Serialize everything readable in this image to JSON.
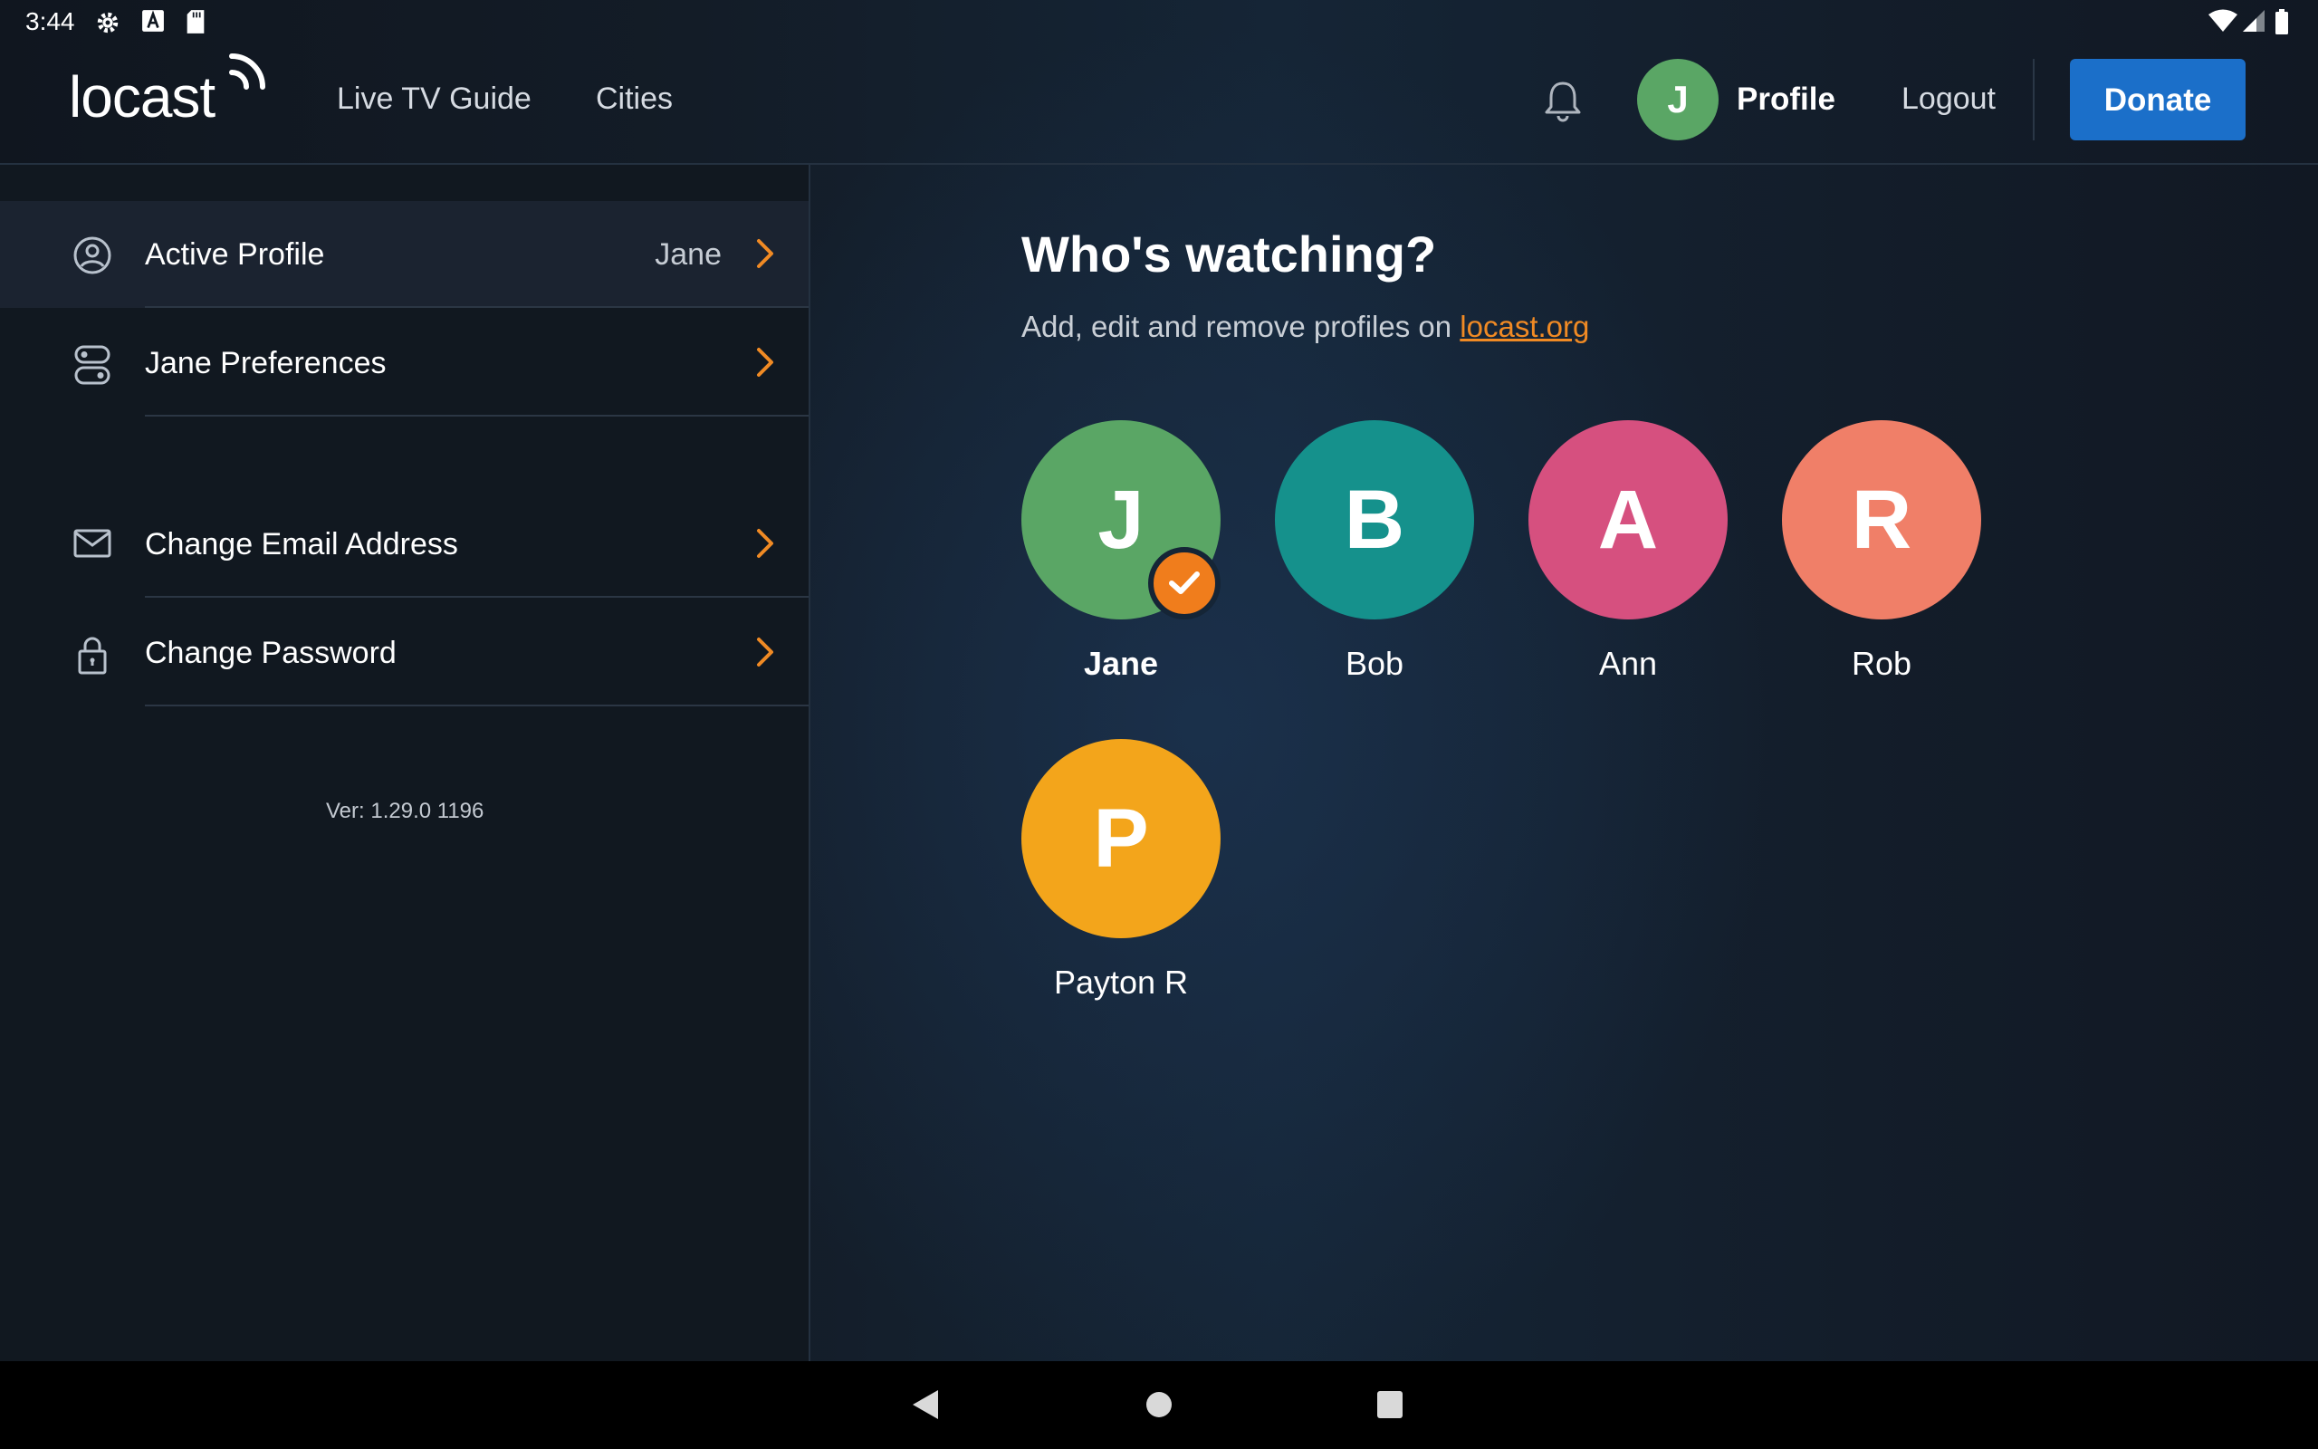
{
  "status_bar": {
    "time": "3:44"
  },
  "header": {
    "logo": "locast",
    "nav": [
      "Live TV Guide",
      "Cities"
    ],
    "avatar_initial": "J",
    "profile_label": "Profile",
    "logout_label": "Logout",
    "donate_label": "Donate"
  },
  "sidebar": {
    "items": [
      {
        "label": "Active Profile",
        "value": "Jane",
        "icon": "user-circle-icon"
      },
      {
        "label": "Jane Preferences",
        "icon": "toggles-icon"
      },
      {
        "label": "Change Email Address",
        "icon": "mail-icon"
      },
      {
        "label": "Change Password",
        "icon": "lock-icon"
      }
    ],
    "version": "Ver: 1.29.0 1196"
  },
  "main": {
    "title": "Who's watching?",
    "subtitle": "Add, edit and remove profiles on ",
    "subtitle_link": "locast.org",
    "profiles": [
      {
        "initial": "J",
        "name": "Jane",
        "color": "#5aa665",
        "active": true
      },
      {
        "initial": "B",
        "name": "Bob",
        "color": "#15918c"
      },
      {
        "initial": "A",
        "name": "Ann",
        "color": "#d6507f"
      },
      {
        "initial": "R",
        "name": "Rob",
        "color": "#f07f68"
      },
      {
        "initial": "P",
        "name": "Payton R",
        "color": "#f3a51b"
      }
    ]
  },
  "colors": {
    "accent": "#f08a24",
    "donate": "#1b6fc9"
  }
}
